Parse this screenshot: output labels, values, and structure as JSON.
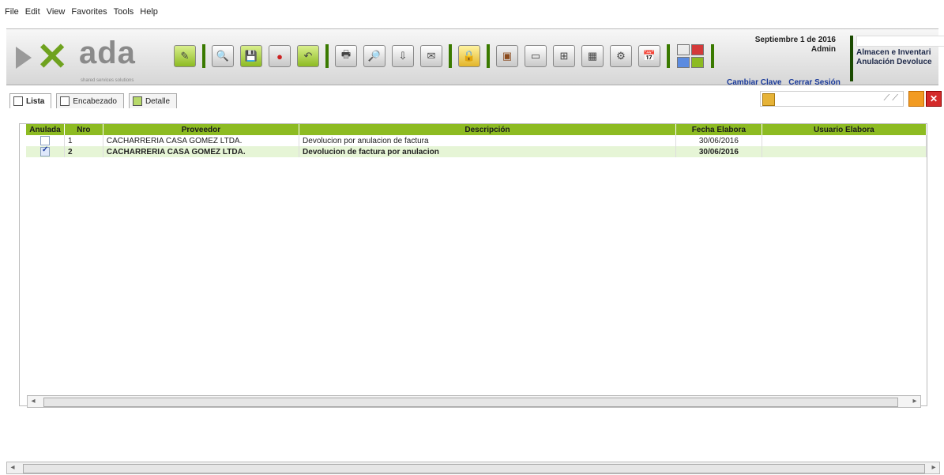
{
  "menu": [
    "File",
    "Edit",
    "View",
    "Favorites",
    "Tools",
    "Help"
  ],
  "logo": {
    "word": "ada",
    "tagline": "shared services solutions"
  },
  "header": {
    "date": "Septiembre 1 de 2016",
    "user": "Admin",
    "links": [
      "Cambiar Clave",
      "Cerrar Sesión"
    ],
    "module_lines": [
      "Almacen e Inventari",
      "Anulación Devoluce"
    ]
  },
  "tabs": [
    "Lista",
    "Encabezado",
    "Detalle"
  ],
  "search": {
    "placeholder": "",
    "value": ""
  },
  "grid": {
    "columns": [
      "Anulada",
      "Nro",
      "Proveedor",
      "Descripción",
      "Fecha Elabora",
      "Usuario Elabora"
    ],
    "rows": [
      {
        "anulada": false,
        "nro": "1",
        "proveedor": "CACHARRERIA CASA GOMEZ LTDA.",
        "descripcion": "Devolucion por anulacion de factura",
        "fecha": "30/06/2016",
        "usuario": ""
      },
      {
        "anulada": true,
        "nro": "2",
        "proveedor": "CACHARRERIA CASA GOMEZ LTDA.",
        "descripcion": "Devolucion de factura por anulacion",
        "fecha": "30/06/2016",
        "usuario": ""
      }
    ]
  },
  "colors": {
    "accent": "#8dbb22",
    "logo_green": "#6fa21f",
    "link_blue": "#1a3a9a"
  }
}
